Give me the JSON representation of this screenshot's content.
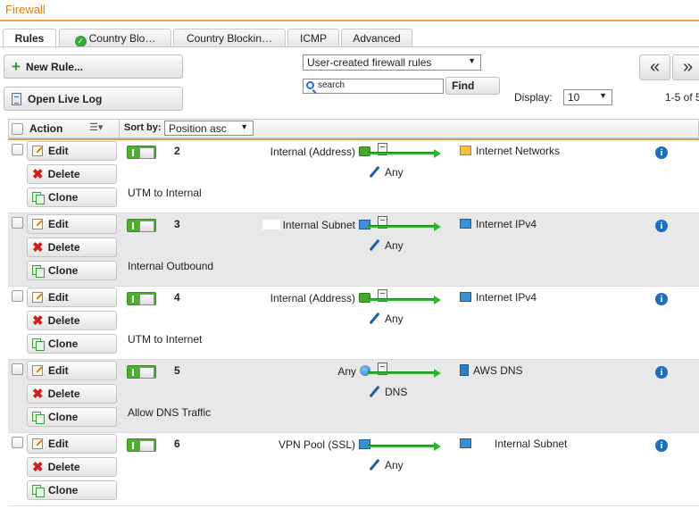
{
  "window": {
    "title": "Firewall"
  },
  "tabs": [
    {
      "label": "Rules"
    },
    {
      "label": "Country Blo…"
    },
    {
      "label": "Country Blockin…"
    },
    {
      "label": "ICMP"
    },
    {
      "label": "Advanced"
    }
  ],
  "toolbar": {
    "new_rule_label": "New Rule...",
    "open_live_log_label": "Open Live Log",
    "filter_select_value": "User-created firewall rules",
    "search_placeholder": "search",
    "find_label": "Find",
    "display_label": "Display:",
    "display_value": "10",
    "range_text": "1-5 of 5",
    "first_glyph": "«",
    "prev_glyph": "»"
  },
  "table": {
    "action_header": "Action",
    "sort_by_label": "Sort by:",
    "sort_value": "Position asc"
  },
  "row_buttons": {
    "edit": "Edit",
    "delete": "Delete",
    "clone": "Clone"
  },
  "rules": [
    {
      "position": "2",
      "source": "Internal (Address)",
      "service": "Any",
      "destination": "Internet Networks",
      "comment": "UTM to Internal"
    },
    {
      "position": "3",
      "source": "Internal Subnet",
      "service": "Any",
      "destination": "Internet IPv4",
      "comment": "Internal Outbound"
    },
    {
      "position": "4",
      "source": "Internal (Address)",
      "service": "Any",
      "destination": "Internet IPv4",
      "comment": "UTM to Internet"
    },
    {
      "position": "5",
      "source": "Any",
      "service": "DNS",
      "destination": "AWS DNS",
      "comment": "Allow DNS Traffic"
    },
    {
      "position": "6",
      "source": "VPN Pool (SSL)",
      "service": "Any",
      "destination": "Internal Subnet",
      "comment": ""
    }
  ],
  "colors": {
    "accent": "#e07d10",
    "enabled": "#4caf2f",
    "info": "#1f6cc0"
  },
  "icons": [
    "check-icon",
    "plus-icon",
    "log-icon",
    "search-icon",
    "edit-icon",
    "delete-icon",
    "clone-icon",
    "info-icon",
    "wrench-icon"
  ]
}
